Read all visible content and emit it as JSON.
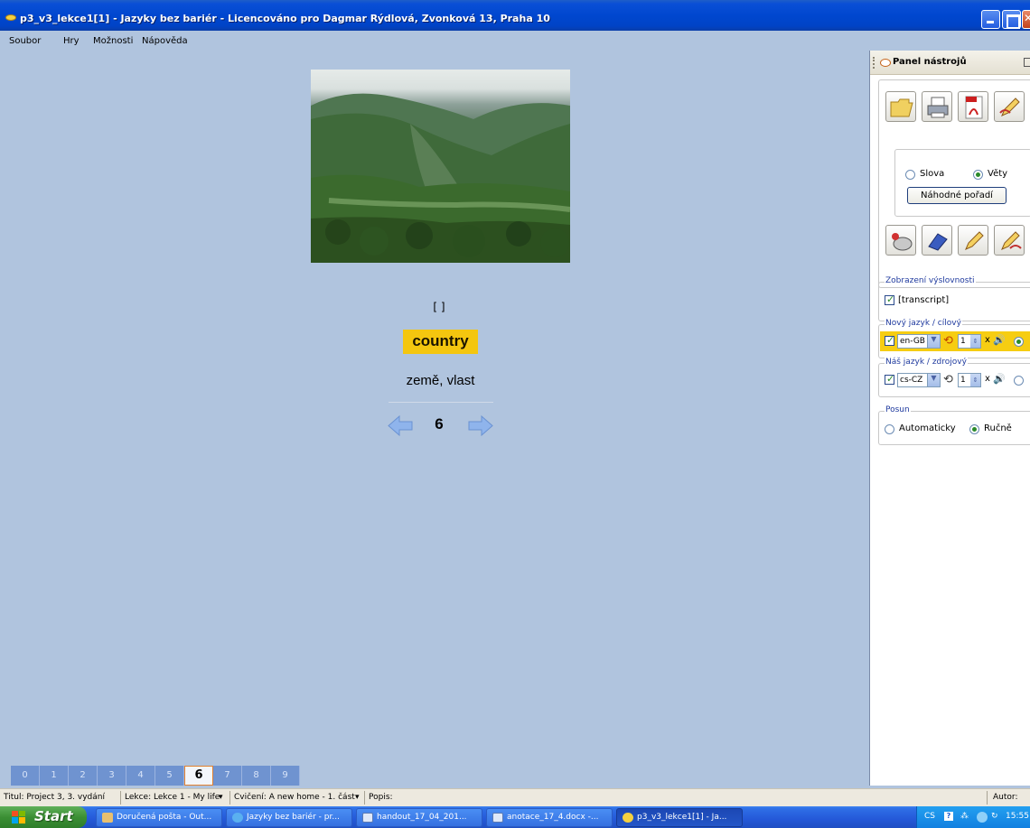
{
  "window": {
    "title": "p3_v3_lekce1[1] - Jazyky bez bariér - Licencováno pro Dagmar Rýdlová, Zvonková 13, Praha 10"
  },
  "menu": [
    {
      "label": "Soubor"
    },
    {
      "label": "Hry"
    },
    {
      "label": "Možnosti"
    },
    {
      "label": "Nápověda"
    }
  ],
  "card": {
    "transcript": "[ ]",
    "word": "country",
    "translation": "země, vlast",
    "number": "6"
  },
  "pages": [
    "0",
    "1",
    "2",
    "3",
    "4",
    "5",
    "6",
    "7",
    "8",
    "9"
  ],
  "active_page": "6",
  "statusbar": {
    "title": "Titul: Project 3, 3. vydání",
    "lesson": "Lekce: Lekce 1 - My life",
    "exercise": "Cvičení: A new home - 1. část",
    "description": "Popis:",
    "author": "Autor:"
  },
  "panel": {
    "title": "Panel nástrojů",
    "mode_words": "Slova",
    "mode_sentences": "Věty",
    "mode_selected": "Věty",
    "random_order": "Náhodné pořadí",
    "pronunciation_group": "Zobrazení výslovnosti",
    "transcript_label": "[transcript]",
    "target_group": "Nový jazyk / cílový",
    "target_lang": "en-GB",
    "target_repeat": "1",
    "times_label": "x",
    "source_group": "Náš jazyk / zdrojový",
    "source_lang": "cs-CZ",
    "source_repeat": "1",
    "advance_group": "Posun",
    "advance_auto": "Automaticky",
    "advance_manual": "Ručně",
    "advance_selected": "Ručně"
  },
  "taskbar": {
    "start": "Start",
    "items": [
      {
        "label": "Doručená pošta - Out..."
      },
      {
        "label": "Jazyky bez bariér - pr..."
      },
      {
        "label": "handout_17_04_201..."
      },
      {
        "label": "anotace_17_4.docx -..."
      },
      {
        "label": "p3_v3_lekce1[1] - Ja..."
      }
    ],
    "tray_lang": "CS",
    "clock": "15:55"
  },
  "colors": {
    "background": "#b0c4de",
    "highlight": "#f4c60f",
    "title_bar": "#0047cf",
    "page_tab": "#6f93d0"
  }
}
